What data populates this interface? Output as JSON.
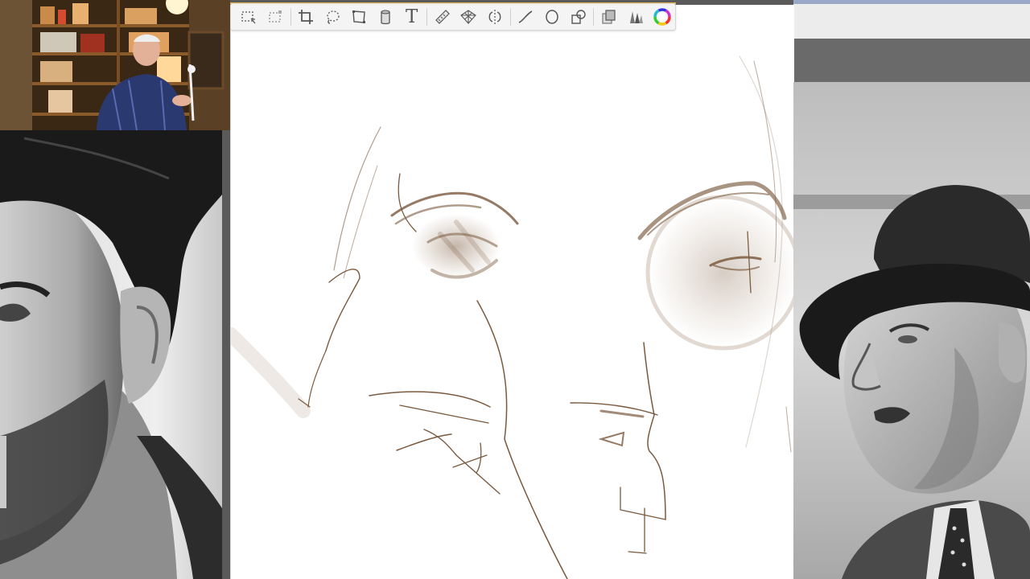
{
  "toolbar": {
    "tools": [
      {
        "id": "rect-select",
        "icon": "marquee-select-icon"
      },
      {
        "id": "transform-select",
        "icon": "transform-select-icon"
      },
      {
        "id": "crop",
        "icon": "crop-icon"
      },
      {
        "id": "lasso",
        "icon": "lasso-icon"
      },
      {
        "id": "perspective",
        "icon": "perspective-crop-icon"
      },
      {
        "id": "fill",
        "icon": "fill-bucket-icon"
      },
      {
        "id": "text",
        "icon": "text-tool-icon",
        "glyph": "T"
      },
      {
        "id": "ruler",
        "icon": "ruler-icon"
      },
      {
        "id": "perspective-grid",
        "icon": "perspective-grid-icon"
      },
      {
        "id": "symmetry",
        "icon": "symmetry-icon"
      },
      {
        "id": "curve",
        "icon": "curve-icon"
      },
      {
        "id": "ellipse",
        "icon": "ellipse-icon"
      },
      {
        "id": "shapes",
        "icon": "shapes-icon"
      },
      {
        "id": "layers",
        "icon": "layers-icon"
      },
      {
        "id": "brushes",
        "icon": "brush-library-icon"
      },
      {
        "id": "color",
        "icon": "color-wheel-icon"
      }
    ],
    "accent_color": "#e7b54a"
  },
  "colors": {
    "canvas": "#ffffff",
    "stroke": "#7a5a3e",
    "shade": "#8a6a4c"
  },
  "panels": {
    "webcam": "webcam-feed",
    "left_reference": "reference-photo-bearded-man",
    "right_reference": "reference-photo-man-in-hat"
  }
}
